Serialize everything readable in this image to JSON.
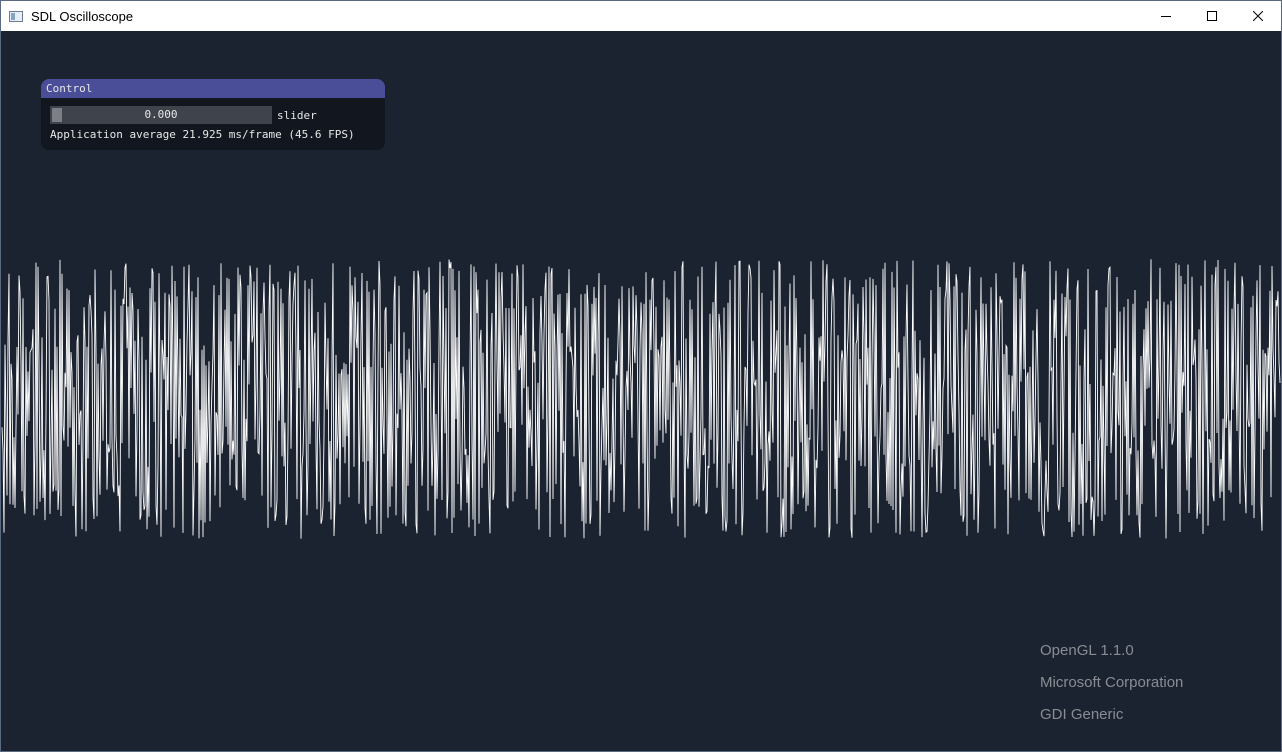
{
  "window": {
    "title": "SDL Oscilloscope"
  },
  "control_panel": {
    "title": "Control",
    "slider_value": "0.000",
    "slider_label": "slider",
    "fps_text": "Application average 21.925 ms/frame (45.6 FPS)"
  },
  "gl_info": {
    "version": "OpenGL 1.1.0",
    "vendor": "Microsoft Corporation",
    "renderer": "GDI Generic"
  },
  "colors": {
    "background": "#1b2230",
    "panel_header": "#4a4d98",
    "waveform": "#ffffff"
  }
}
